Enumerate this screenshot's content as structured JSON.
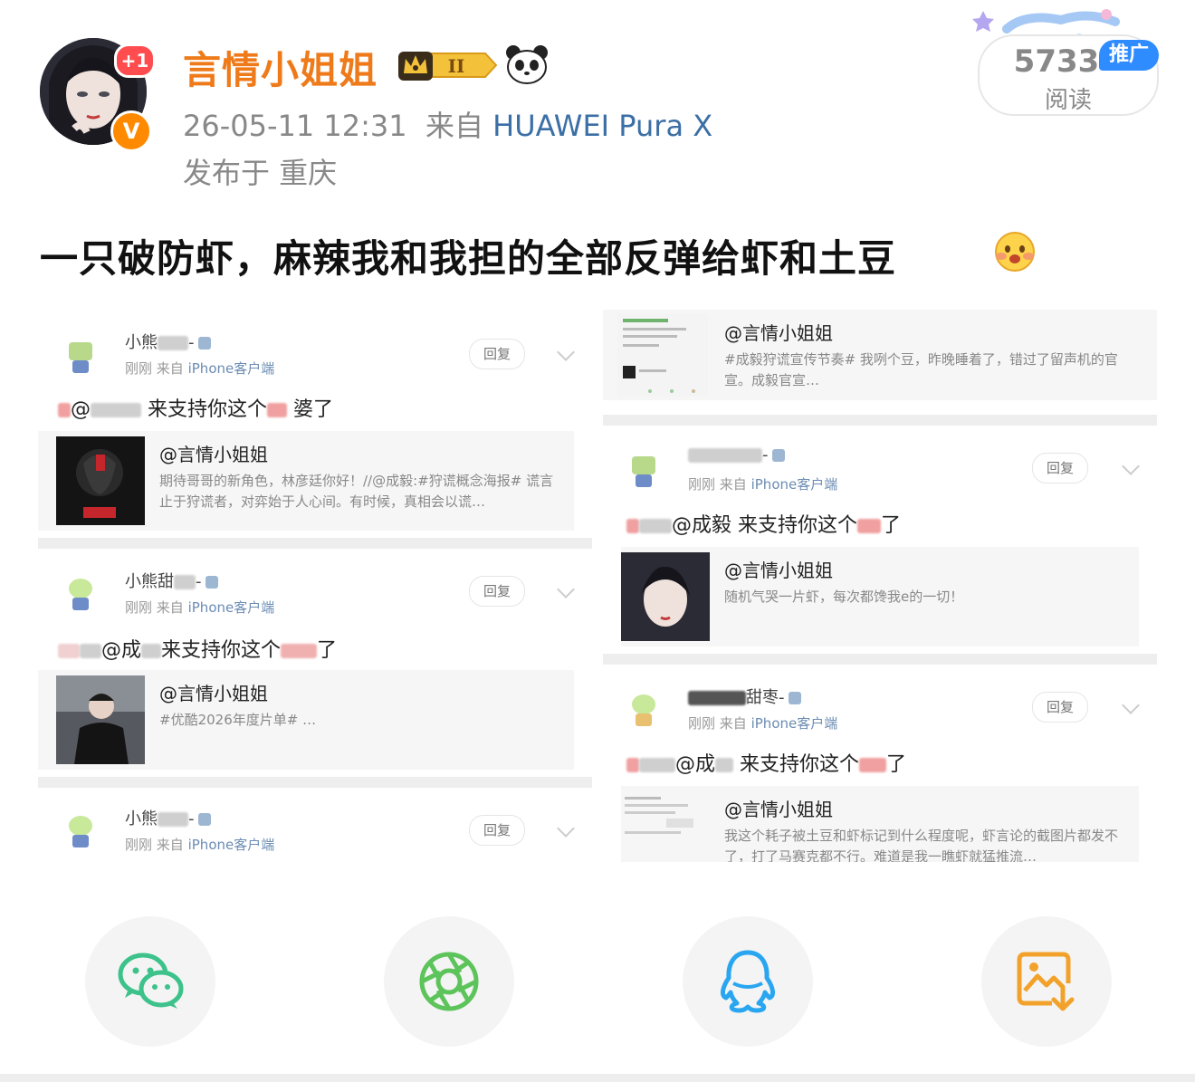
{
  "header": {
    "username": "言情小姐姐",
    "plus_badge": "+1",
    "verify_badge": "V",
    "crown_level": "II",
    "date": "26-05-11 12:31",
    "from_label": "来自",
    "device": "HUAWEI Pura X",
    "location": "发布于 重庆"
  },
  "reads": {
    "count": "5733",
    "label": "阅读",
    "promo": "推广"
  },
  "post": {
    "text": "一只破防虾，麻辣我和我担的全部反弹给虾和土豆"
  },
  "screenshot_left": [
    {
      "name_prefix": "小熊",
      "name_suffix": "-",
      "meta_time": "刚刚",
      "meta_from": "来自",
      "meta_device": "iPhone客户端",
      "reply": "回复",
      "body_prefix": "@",
      "body": "来支持你这个",
      "body_suffix": "婆了",
      "quote_title": "@言情小姐姐",
      "quote_text": "期待哥哥的新角色，林彦廷你好！//@成毅:#狩谎概念海报# 谎言止于狩谎者，对弈始于人心间。有时候，真相会以谎…"
    },
    {
      "name_prefix": "小熊甜",
      "name_suffix": "-",
      "meta_time": "刚刚",
      "meta_from": "来自",
      "meta_device": "iPhone客户端",
      "reply": "回复",
      "body_prefix": "@成",
      "body": "来支持你这个",
      "body_suffix": "了",
      "quote_title": "@言情小姐姐",
      "quote_text": "#优酷2026年度片单# …"
    },
    {
      "name_prefix": "小熊",
      "name_suffix": "-",
      "meta_time": "刚刚",
      "meta_from": "来自",
      "meta_device": "iPhone客户端",
      "reply": "回复"
    }
  ],
  "screenshot_right": [
    {
      "quote_title": "@言情小姐姐",
      "quote_text": "#成毅狩谎宣传节奏# 我咧个豆，昨晚睡着了，错过了留声机的官宣。成毅官宣…"
    },
    {
      "name_prefix": "",
      "name_suffix": "-",
      "meta_time": "刚刚",
      "meta_from": "来自",
      "meta_device": "iPhone客户端",
      "reply": "回复",
      "body_prefix": "@成毅",
      "body": "来支持你这个",
      "body_suffix": "了",
      "quote_title": "@言情小姐姐",
      "quote_text": "随机气哭一片虾，每次都馋我e的一切！"
    },
    {
      "name_prefix": "甜枣",
      "name_suffix": "-",
      "meta_time": "刚刚",
      "meta_from": "来自",
      "meta_device": "iPhone客户端",
      "reply": "回复",
      "body_prefix": "@成",
      "body": "来支持你这个",
      "body_suffix": "了",
      "quote_title": "@言情小姐姐",
      "quote_text": "我这个耗子被土豆和虾标记到什么程度呢，虾言论的截图片都发不了，打了马赛克都不行。难道是我一瞧虾就猛推流…"
    }
  ],
  "share_bar": {
    "icons": [
      "wechat-icon",
      "moments-icon",
      "qq-icon",
      "save-image-icon"
    ],
    "colors": {
      "wechat": "#3cc28a",
      "moments": "#5cc45a",
      "qq": "#2aa6f0",
      "save": "#f2a22b"
    }
  },
  "colors": {
    "username": "#ef7a1a",
    "device_link": "#3b6fa5",
    "promo": "#2f8cff"
  }
}
